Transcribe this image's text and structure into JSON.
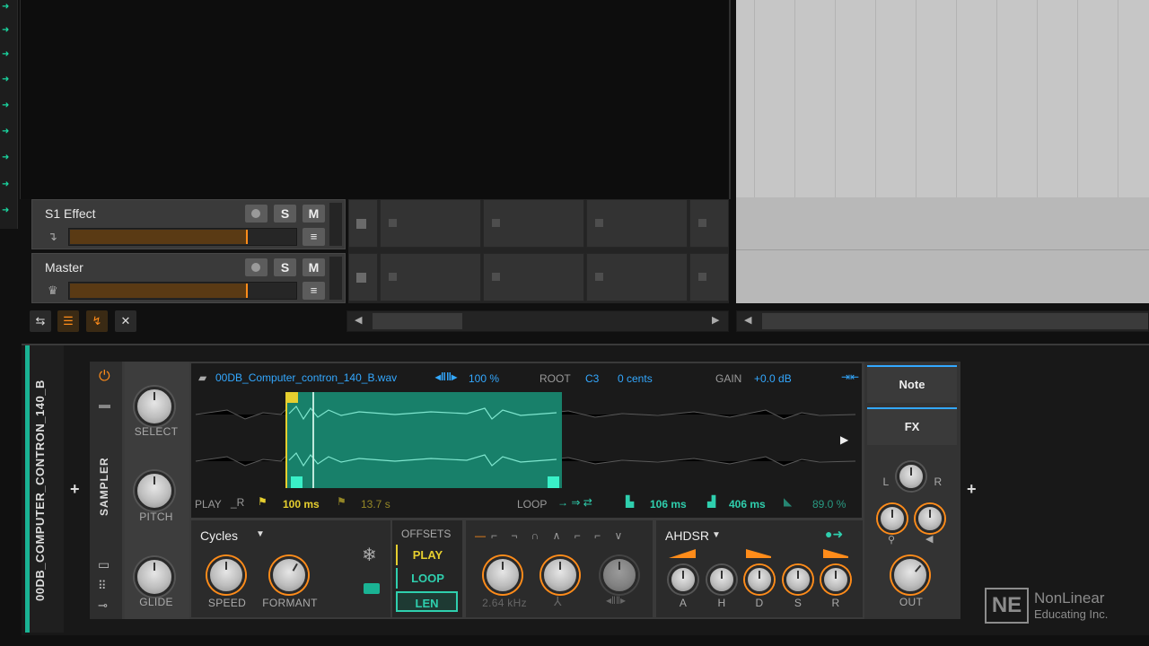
{
  "tracks": [
    {
      "name": "S1 Effect",
      "solo": "S",
      "mute": "M",
      "menu": "≡",
      "icon": "arrow-down-icon"
    },
    {
      "name": "Master",
      "solo": "S",
      "mute": "M",
      "menu": "≡",
      "icon": "crown-icon"
    }
  ],
  "toolbar": {
    "close": "✕"
  },
  "device": {
    "track_name": "00DB_COMPUTER_CONTRON_140_B",
    "device_name": "SAMPLER",
    "left_knobs": {
      "select": "SELECT",
      "pitch": "PITCH",
      "glide": "GLIDE"
    },
    "file": "00DB_Computer_contron_140_B.wav",
    "speed_pct": "100 %",
    "root_label": "ROOT",
    "root_note": "C3",
    "cents": "0 cents",
    "gain_label": "GAIN",
    "gain": "+0.0 dB",
    "play_label": "PLAY",
    "play_start": "100 ms",
    "play_end": "13.7 s",
    "loop_label": "LOOP",
    "loop_start": "106 ms",
    "loop_len": "406 ms",
    "loop_crossfade": "89.0 %",
    "mode": "Cycles",
    "speed_label": "SPEED",
    "formant_label": "FORMANT",
    "offsets_label": "OFFSETS",
    "offsets": [
      "PLAY",
      "LOOP",
      "LEN"
    ],
    "filter_freq": "2.64 kHz",
    "env_label": "AHDSR",
    "env_knobs": [
      "A",
      "H",
      "D",
      "S",
      "R"
    ],
    "note_btn": "Note",
    "fx_btn": "FX",
    "pan_l": "L",
    "pan_r": "R",
    "out_label": "OUT"
  },
  "watermark": {
    "line1": "NonLinear",
    "line2": "Educating Inc.",
    "mark": "NE"
  },
  "colors": {
    "accent_teal": "#1ab394",
    "accent_orange": "#ff8c1a",
    "accent_blue": "#33a8ff",
    "accent_yellow": "#e6cf2f"
  }
}
